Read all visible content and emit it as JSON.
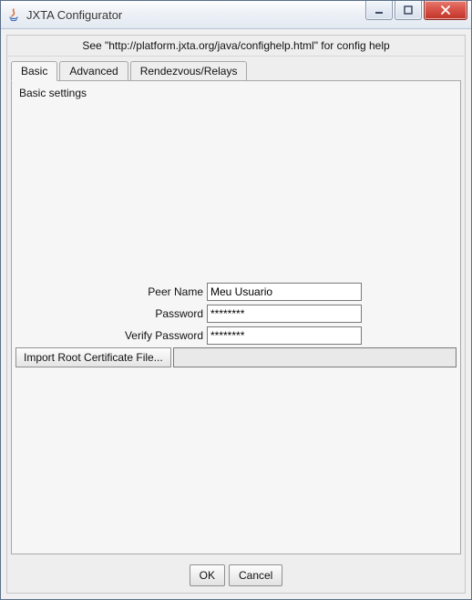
{
  "window": {
    "title": "JXTA Configurator"
  },
  "help_text": "See \"http://platform.jxta.org/java/confighelp.html\" for config help",
  "tabs": {
    "basic": "Basic",
    "advanced": "Advanced",
    "rendezvous": "Rendezvous/Relays"
  },
  "section_title": "Basic settings",
  "form": {
    "peer_name_label": "Peer Name",
    "peer_name_value": "Meu Usuario",
    "password_label": "Password",
    "password_value": "********",
    "verify_password_label": "Verify Password",
    "verify_password_value": "********",
    "import_cert_label": "Import Root Certificate File...",
    "import_cert_path": ""
  },
  "buttons": {
    "ok": "OK",
    "cancel": "Cancel"
  }
}
